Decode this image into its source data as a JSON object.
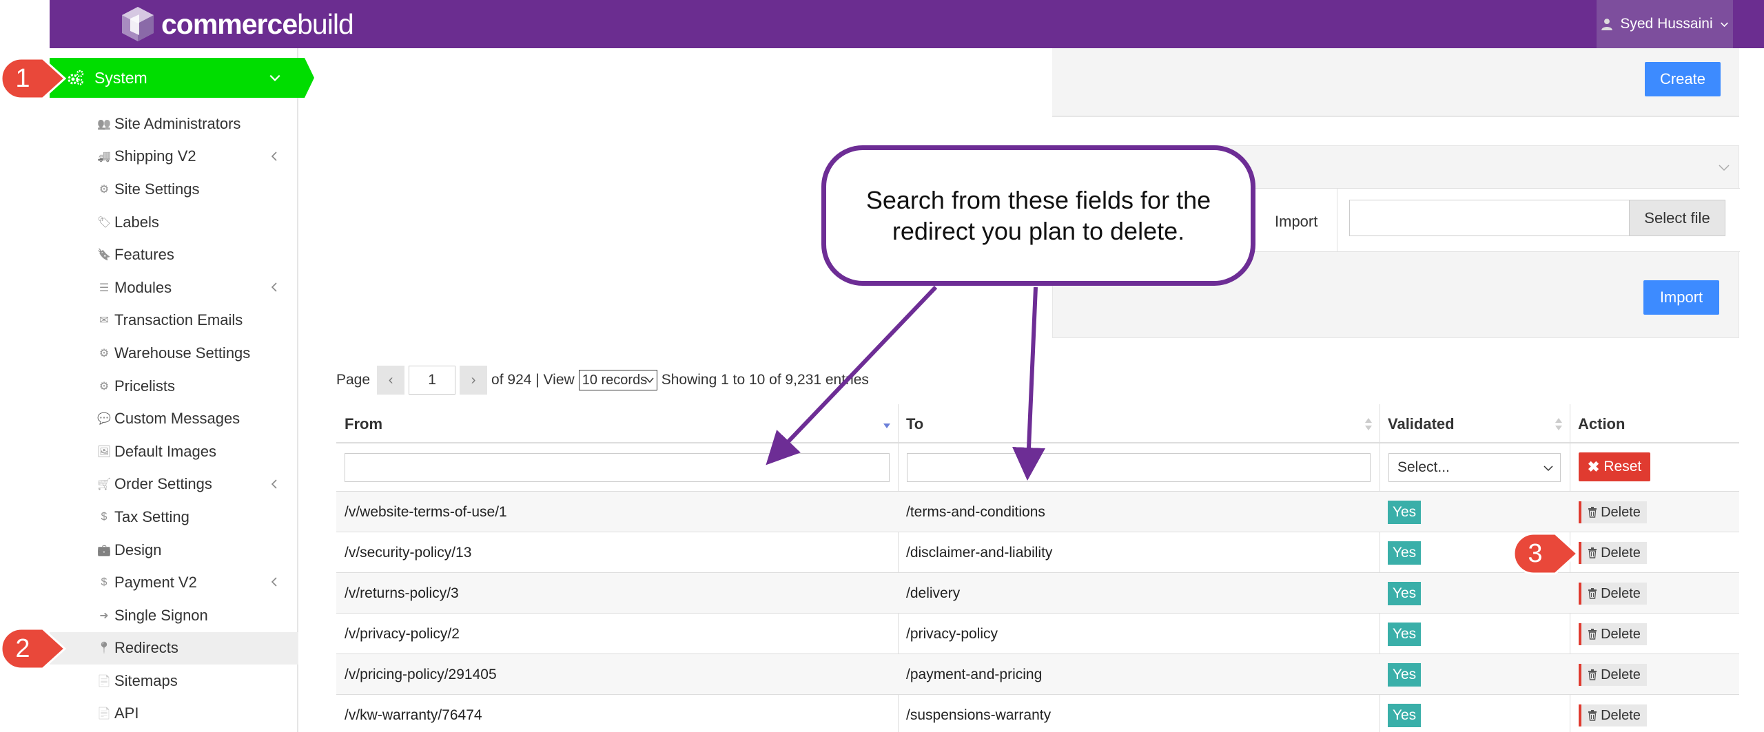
{
  "brand": {
    "name_bold": "commerce",
    "name_light": "build"
  },
  "header": {
    "user_name": "Syed Hussaini"
  },
  "sidebar": {
    "system_label": "System",
    "items": [
      {
        "label": "Site Administrators",
        "icon": "users-icon"
      },
      {
        "label": "Shipping V2",
        "icon": "truck-icon",
        "expandable": true
      },
      {
        "label": "Site Settings",
        "icon": "gear-icon"
      },
      {
        "label": "Labels",
        "icon": "tags-icon"
      },
      {
        "label": "Features",
        "icon": "bookmark-icon"
      },
      {
        "label": "Modules",
        "icon": "list-icon",
        "expandable": true
      },
      {
        "label": "Transaction Emails",
        "icon": "envelope-icon"
      },
      {
        "label": "Warehouse Settings",
        "icon": "gear-icon"
      },
      {
        "label": "Pricelists",
        "icon": "gears-icon"
      },
      {
        "label": "Custom Messages",
        "icon": "comment-icon"
      },
      {
        "label": "Default Images",
        "icon": "image-icon"
      },
      {
        "label": "Order Settings",
        "icon": "cart-icon",
        "expandable": true
      },
      {
        "label": "Tax Setting",
        "icon": "dollar-icon"
      },
      {
        "label": "Design",
        "icon": "briefcase-icon"
      },
      {
        "label": "Payment V2",
        "icon": "dollar-icon",
        "expandable": true
      },
      {
        "label": "Single Signon",
        "icon": "sign-in-icon"
      },
      {
        "label": "Redirects",
        "icon": "map-marker-icon",
        "active": true
      },
      {
        "label": "Sitemaps",
        "icon": "file-icon"
      },
      {
        "label": "API",
        "icon": "file-icon"
      }
    ]
  },
  "panels": {
    "create_label": "Create",
    "import_label": "Import",
    "select_file_label": "Select file",
    "import_button_label": "Import"
  },
  "pager": {
    "page_label": "Page",
    "current_page": "1",
    "of_text": "of 924 | View",
    "view_option": "10 records",
    "showing_text": "Showing 1 to 10 of 9,231 entries"
  },
  "table": {
    "columns": [
      "From",
      "To",
      "Validated",
      "Action"
    ],
    "validated_placeholder": "Select...",
    "reset_label": "Reset",
    "rows": [
      {
        "from": "/v/website-terms-of-use/1",
        "to": "/terms-and-conditions",
        "validated": "Yes",
        "action": "Delete"
      },
      {
        "from": "/v/security-policy/13",
        "to": "/disclaimer-and-liability",
        "validated": "Yes",
        "action": "Delete"
      },
      {
        "from": "/v/returns-policy/3",
        "to": "/delivery",
        "validated": "Yes",
        "action": "Delete"
      },
      {
        "from": "/v/privacy-policy/2",
        "to": "/privacy-policy",
        "validated": "Yes",
        "action": "Delete"
      },
      {
        "from": "/v/pricing-policy/291405",
        "to": "/payment-and-pricing",
        "validated": "Yes",
        "action": "Delete"
      },
      {
        "from": "/v/kw-warranty/76474",
        "to": "/suspensions-warranty",
        "validated": "Yes",
        "action": "Delete"
      }
    ]
  },
  "annotations": {
    "callout_text": "Search from these fields for the redirect you plan to delete.",
    "badges": [
      "1",
      "2",
      "3"
    ]
  },
  "colors": {
    "header": "#6b2d90",
    "system_green": "#00dd00",
    "primary_blue": "#3d8bff",
    "danger_red": "#e03b30",
    "yes_teal": "#3aafa9",
    "annotation_purple": "#6d2d95",
    "badge_red": "#e9483a"
  }
}
